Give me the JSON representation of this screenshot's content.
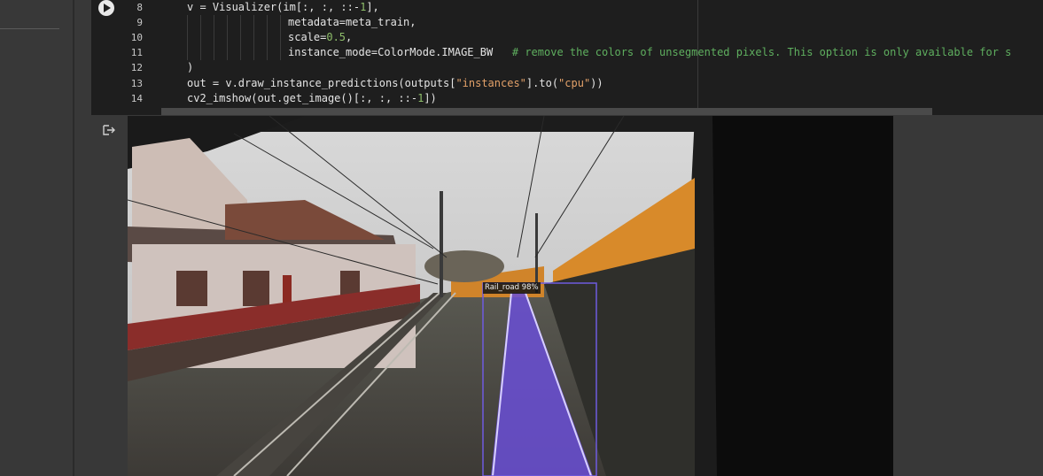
{
  "code_cell": {
    "lines": [
      {
        "num": "8"
      },
      {
        "num": "9"
      },
      {
        "num": "10"
      },
      {
        "num": "11"
      },
      {
        "num": "12"
      },
      {
        "num": "13"
      },
      {
        "num": "14"
      }
    ],
    "line8": {
      "a": "v = Visualizer(im[:, :, ::-",
      "b": "1",
      "c": "],"
    },
    "line9": {
      "a": "metadata=meta_train,"
    },
    "line10": {
      "a": "scale=",
      "b": "0.5",
      "c": ","
    },
    "line11": {
      "a": "instance_mode=ColorMode.IMAGE_BW",
      "comment": "# remove the colors of unsegmented pixels. This option is only available for s"
    },
    "line12": {
      "a": ")"
    },
    "line13": {
      "a": "out = v.draw_instance_predictions(outputs[",
      "s1": "\"instances\"",
      "b": "].to(",
      "s2": "\"cpu\"",
      "c": "))"
    },
    "line14": {
      "a": "cv2_imshow(out.get_image()[:, :, ::-",
      "b": "1",
      "c": "])"
    }
  },
  "run_button": {
    "icon": "play-icon"
  },
  "output": {
    "icon": "output-redirect-icon",
    "detection": {
      "label": "Rail_road 98%",
      "class": "Rail_road",
      "score_percent": 98
    },
    "colors": {
      "mask": "#6a4fd6",
      "box": "#6f5be0",
      "fence": "#d88a2a"
    }
  }
}
